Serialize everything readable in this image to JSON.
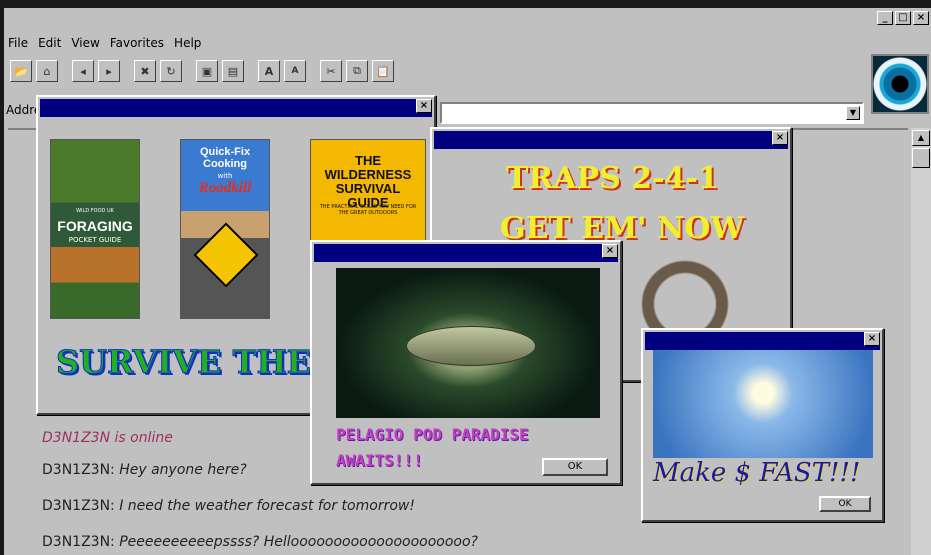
{
  "window": {
    "min_label": "_",
    "max_label": "□",
    "close_label": "×"
  },
  "menu": [
    "File",
    "Edit",
    "View",
    "Favorites",
    "Help"
  ],
  "address": {
    "label": "Address"
  },
  "books": [
    {
      "title": "FORAGING",
      "subtitle": "POCKET GUIDE",
      "series": "WILD FOOD UK"
    },
    {
      "title": "Quick-Fix Cooking",
      "subtitle": "with",
      "title2": "Roadkill"
    },
    {
      "title": "THE WILDERNESS SURVIVAL GUIDE",
      "subtitle": "THE PRACTICAL SKILLS YOU NEED FOR THE GREAT OUTDOORS"
    }
  ],
  "ads": {
    "survive": "SURVIVE THE W",
    "traps_line1": "TRAPS 2-4-1",
    "traps_line2": "GET EM' NOW",
    "pelagio": "PELAGIO POD PARADISE AWAITS!!!",
    "money": "Make $ FAST!!!",
    "ok": "OK"
  },
  "chat": {
    "status": "D3N1Z3N is online",
    "messages": [
      {
        "user": "D3N1Z3N:",
        "text": "Hey anyone here?"
      },
      {
        "user": "D3N1Z3N:",
        "text": "I need the weather forecast for tomorrow!"
      },
      {
        "user": "D3N1Z3N:",
        "text": "Peeeeeeeeeepssss? Hellooooooooooooooooooooo?"
      }
    ]
  }
}
